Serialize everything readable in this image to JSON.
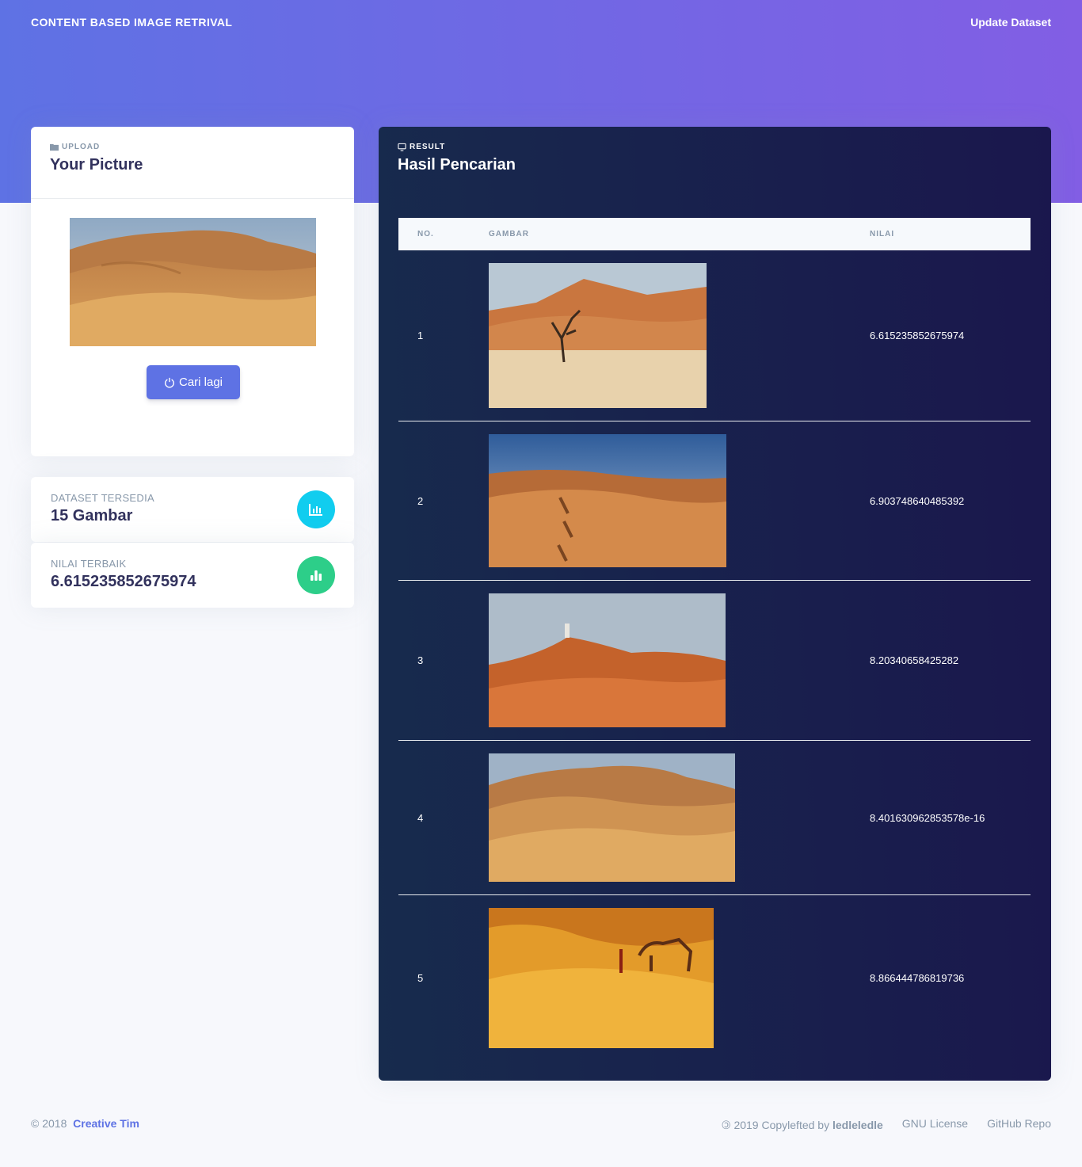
{
  "nav": {
    "brand": "CONTENT BASED IMAGE RETRIVAL",
    "update_link": "Update Dataset"
  },
  "upload": {
    "eyebrow": "Upload",
    "title": "Your Picture",
    "image_alt": "sand dunes query image",
    "button_label": "Cari lagi"
  },
  "stats": [
    {
      "label": "Dataset Tersedia",
      "value": "15 Gambar",
      "icon": "chart-bar-icon",
      "color": "#11cdef"
    },
    {
      "label": "Nilai Terbaik",
      "value": "6.615235852675974",
      "icon": "bar-chart-icon",
      "color": "#2dce89"
    }
  ],
  "result": {
    "eyebrow": "Result",
    "title": "Hasil Pencarian",
    "columns": [
      "No.",
      "Gambar",
      "Nilai"
    ],
    "rows": [
      {
        "no": "1",
        "nilai": "6.615235852675974"
      },
      {
        "no": "2",
        "nilai": "6.903748640485392"
      },
      {
        "no": "3",
        "nilai": "8.20340658425282"
      },
      {
        "no": "4",
        "nilai": "8.401630962853578e-16"
      },
      {
        "no": "5",
        "nilai": "8.866444786819736"
      }
    ]
  },
  "footer": {
    "copyright": "© 2018",
    "company": "Creative Tim",
    "copyleft_prefix": "🄯 2019 Copylefted by",
    "copyleft_author": "ledleledle",
    "links": [
      "GNU License",
      "GitHub Repo"
    ]
  },
  "colors": {
    "primary": "#5e72e4",
    "gradient_end": "#825ee4",
    "dark_card": "#172b4d",
    "info": "#11cdef",
    "success": "#2dce89"
  }
}
